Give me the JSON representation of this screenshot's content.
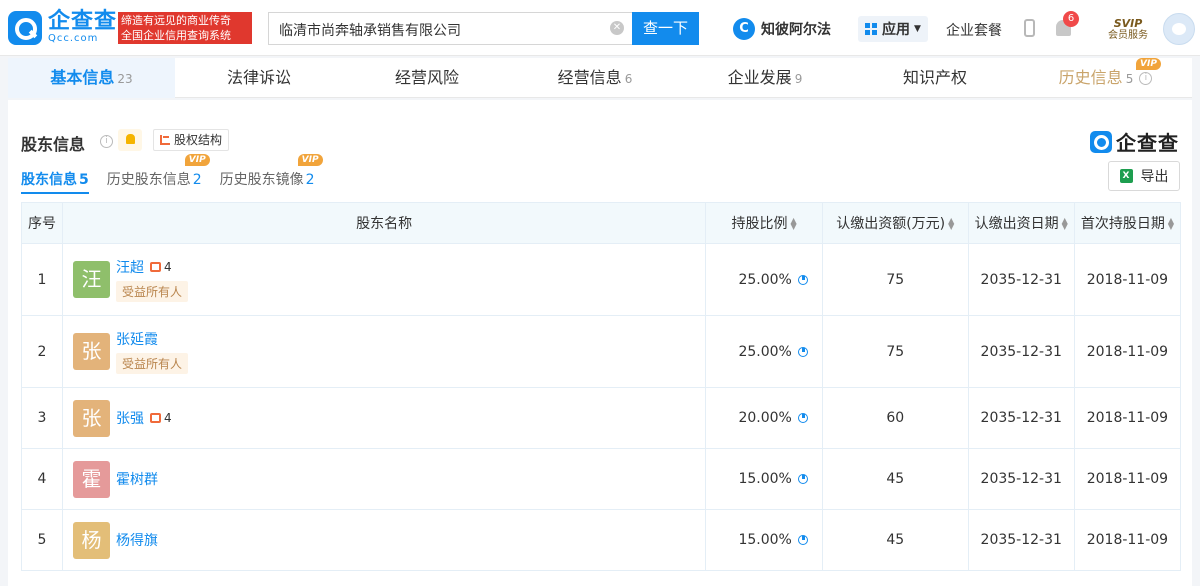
{
  "header": {
    "logo_cn": "企查查",
    "logo_en": "Qcc.com",
    "slogan_line1": "缔造有远见的商业传奇",
    "slogan_line2": "全国企业信用查询系统",
    "search_value": "临清市尚奔轴承销售有限公司",
    "search_button": "查一下",
    "zhibi_label": "知彼阿尔法",
    "zhibi_icon": "C",
    "app_label": "应用",
    "suite_label": "企业套餐",
    "notification_count": "6",
    "svip_top": "SVIP",
    "svip_bottom": "会员服务"
  },
  "tabs": [
    {
      "label": "基本信息",
      "count": "23"
    },
    {
      "label": "法律诉讼",
      "count": ""
    },
    {
      "label": "经营风险",
      "count": ""
    },
    {
      "label": "经营信息",
      "count": "6"
    },
    {
      "label": "企业发展",
      "count": "9"
    },
    {
      "label": "知识产权",
      "count": ""
    },
    {
      "label": "历史信息",
      "count": "5",
      "vip": "VIP"
    }
  ],
  "section": {
    "title": "股东信息",
    "equity_structure": "股权结构",
    "brand": "企查查",
    "export": "导出",
    "subtabs": [
      {
        "label": "股东信息",
        "num": "5"
      },
      {
        "label": "历史股东信息",
        "num": "2",
        "vip": "VIP"
      },
      {
        "label": "历史股东镜像",
        "num": "2",
        "vip": "VIP"
      }
    ]
  },
  "table": {
    "headers": {
      "index": "序号",
      "name": "股东名称",
      "ratio": "持股比例",
      "capital": "认缴出资额(万元)",
      "date": "认缴出资日期",
      "first_date": "首次持股日期"
    },
    "rows": [
      {
        "index": "1",
        "avatar": "汪",
        "avatar_color": "#8fbf6b",
        "name": "汪超",
        "rel": "4",
        "tag": "受益所有人",
        "ratio": "25.00%",
        "capital": "75",
        "date": "2035-12-31",
        "first_date": "2018-11-09"
      },
      {
        "index": "2",
        "avatar": "张",
        "avatar_color": "#e3b37a",
        "name": "张延霞",
        "rel": "",
        "tag": "受益所有人",
        "ratio": "25.00%",
        "capital": "75",
        "date": "2035-12-31",
        "first_date": "2018-11-09"
      },
      {
        "index": "3",
        "avatar": "张",
        "avatar_color": "#e3b37a",
        "name": "张强",
        "rel": "4",
        "tag": "",
        "ratio": "20.00%",
        "capital": "60",
        "date": "2035-12-31",
        "first_date": "2018-11-09"
      },
      {
        "index": "4",
        "avatar": "霍",
        "avatar_color": "#e59a9a",
        "name": "霍树群",
        "rel": "",
        "tag": "",
        "ratio": "15.00%",
        "capital": "45",
        "date": "2035-12-31",
        "first_date": "2018-11-09"
      },
      {
        "index": "5",
        "avatar": "杨",
        "avatar_color": "#e3be78",
        "name": "杨得旗",
        "rel": "",
        "tag": "",
        "ratio": "15.00%",
        "capital": "45",
        "date": "2035-12-31",
        "first_date": "2018-11-09"
      }
    ]
  },
  "colors": {
    "brand": "#128bed",
    "vip": "#f1a43b",
    "owner_tag_bg": "#fdf3e6",
    "owner_tag_text": "#b9854d"
  }
}
